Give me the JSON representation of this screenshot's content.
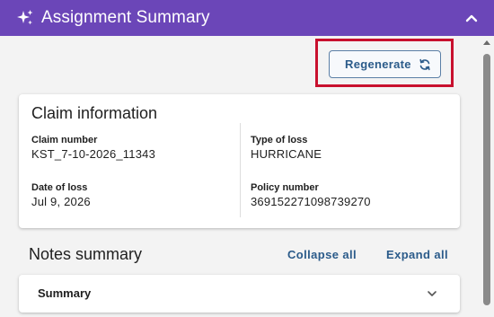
{
  "header": {
    "title": "Assignment Summary",
    "sparkle_icon": "sparkle-icon",
    "collapse_icon": "chevron-up-icon",
    "color": "#6b46b8"
  },
  "toolbar": {
    "regenerate_label": "Regenerate",
    "regenerate_icon": "refresh-icon",
    "highlight_color": "#c8102e"
  },
  "claim_info": {
    "title": "Claim information",
    "fields": {
      "claim_number": {
        "label": "Claim number",
        "value": "KST_7-10-2026_11343"
      },
      "type_of_loss": {
        "label": "Type of loss",
        "value": "HURRICANE"
      },
      "date_of_loss": {
        "label": "Date of loss",
        "value": "Jul 9, 2026"
      },
      "policy_number": {
        "label": "Policy number",
        "value": "369152271098739270"
      }
    }
  },
  "notes": {
    "title": "Notes summary",
    "collapse_all": "Collapse all",
    "expand_all": "Expand all",
    "sections": [
      {
        "label": "Summary",
        "icon": "chevron-down-icon"
      }
    ]
  },
  "colors": {
    "link": "#2b5b8a"
  }
}
